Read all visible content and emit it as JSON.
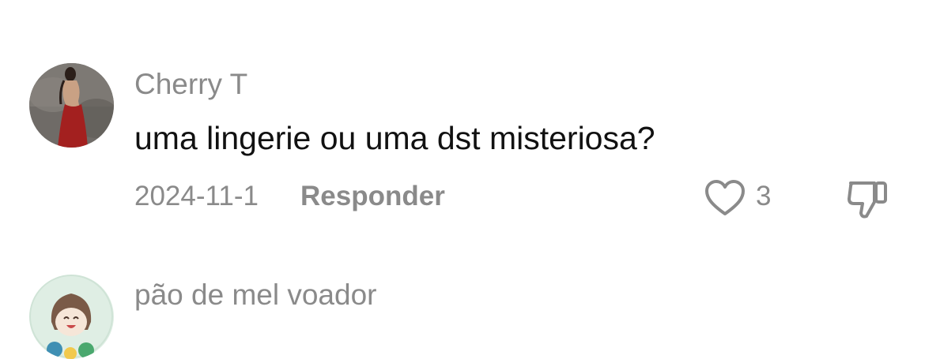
{
  "comments": [
    {
      "username": "Cherry T",
      "text": "uma lingerie ou uma dst misteriosa?",
      "date": "2024-11-1",
      "reply_label": "Responder",
      "like_count": "3",
      "icons": {
        "like": "heart-outline-icon",
        "dislike": "thumbs-down-outline-icon"
      }
    },
    {
      "username": "pão de mel voador"
    }
  ]
}
